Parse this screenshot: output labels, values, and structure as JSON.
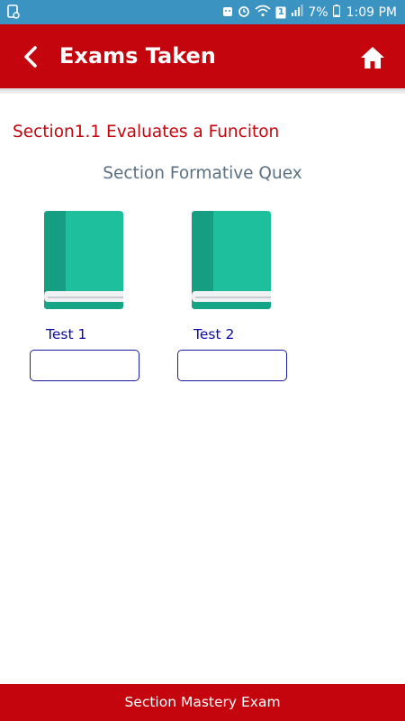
{
  "status_bar": {
    "battery": "7%",
    "time": "1:09 PM",
    "notification_count": "1"
  },
  "header": {
    "title": "Exams Taken"
  },
  "section": {
    "heading": "Section1.1 Evaluates a Funciton",
    "subtitle": "Section Formative Quex"
  },
  "tests": [
    {
      "label": "Test 1",
      "value": ""
    },
    {
      "label": "Test 2",
      "value": ""
    }
  ],
  "footer": {
    "label": "Section Mastery Exam"
  },
  "colors": {
    "status_bar": "#3a93c1",
    "brand_red": "#c4050d",
    "book_cover": "#1dbf9c",
    "test_label": "#0a0aa3"
  }
}
